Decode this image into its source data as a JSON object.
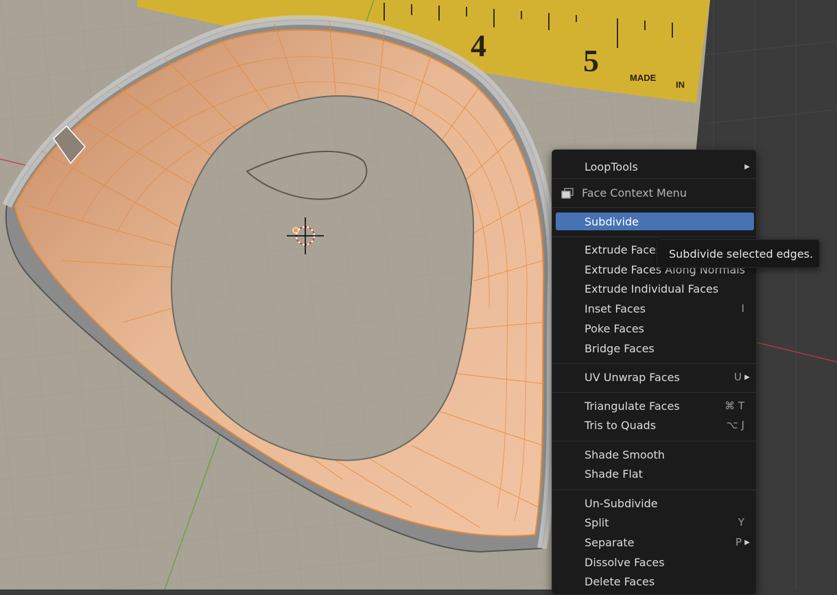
{
  "viewport": {
    "ruler_numbers": [
      "4",
      "5"
    ],
    "ruler_text": [
      "MADE",
      "IN"
    ]
  },
  "menu": {
    "title": "Face Context Menu",
    "items": [
      {
        "label": "LoopTools",
        "shortcut": "",
        "submenu": true
      },
      {
        "label": "Subdivide",
        "shortcut": "",
        "submenu": false,
        "highlighted": true
      },
      {
        "label": "Extrude Faces",
        "shortcut": "",
        "submenu": false
      },
      {
        "label": "Extrude Faces Along Normals",
        "shortcut": "",
        "submenu": false
      },
      {
        "label": "Extrude Individual Faces",
        "shortcut": "",
        "submenu": false
      },
      {
        "label": "Inset Faces",
        "shortcut": "I",
        "submenu": false
      },
      {
        "label": "Poke Faces",
        "shortcut": "",
        "submenu": false
      },
      {
        "label": "Bridge Faces",
        "shortcut": "",
        "submenu": false
      },
      {
        "label": "UV Unwrap Faces",
        "shortcut": "U",
        "submenu": true
      },
      {
        "label": "Triangulate Faces",
        "shortcut": "⌘ T",
        "submenu": false
      },
      {
        "label": "Tris to Quads",
        "shortcut": "⌥ J",
        "submenu": false
      },
      {
        "label": "Shade Smooth",
        "shortcut": "",
        "submenu": false
      },
      {
        "label": "Shade Flat",
        "shortcut": "",
        "submenu": false
      },
      {
        "label": "Un-Subdivide",
        "shortcut": "",
        "submenu": false
      },
      {
        "label": "Split",
        "shortcut": "Y",
        "submenu": false
      },
      {
        "label": "Separate",
        "shortcut": "P",
        "submenu": true
      },
      {
        "label": "Dissolve Faces",
        "shortcut": "",
        "submenu": false
      },
      {
        "label": "Delete Faces",
        "shortcut": "",
        "submenu": false
      }
    ]
  },
  "tooltip": {
    "text": "Subdivide selected edges."
  },
  "colors": {
    "mesh_selected": "#f0a060",
    "menu_bg": "#1b1b1b",
    "highlight": "#4772b3",
    "x_axis": "#c0394a",
    "y_axis": "#6aa03a",
    "ruler": "#d8b531"
  },
  "icons": {
    "face_context": "face-select-icon",
    "submenu": "triangle-right-icon"
  }
}
